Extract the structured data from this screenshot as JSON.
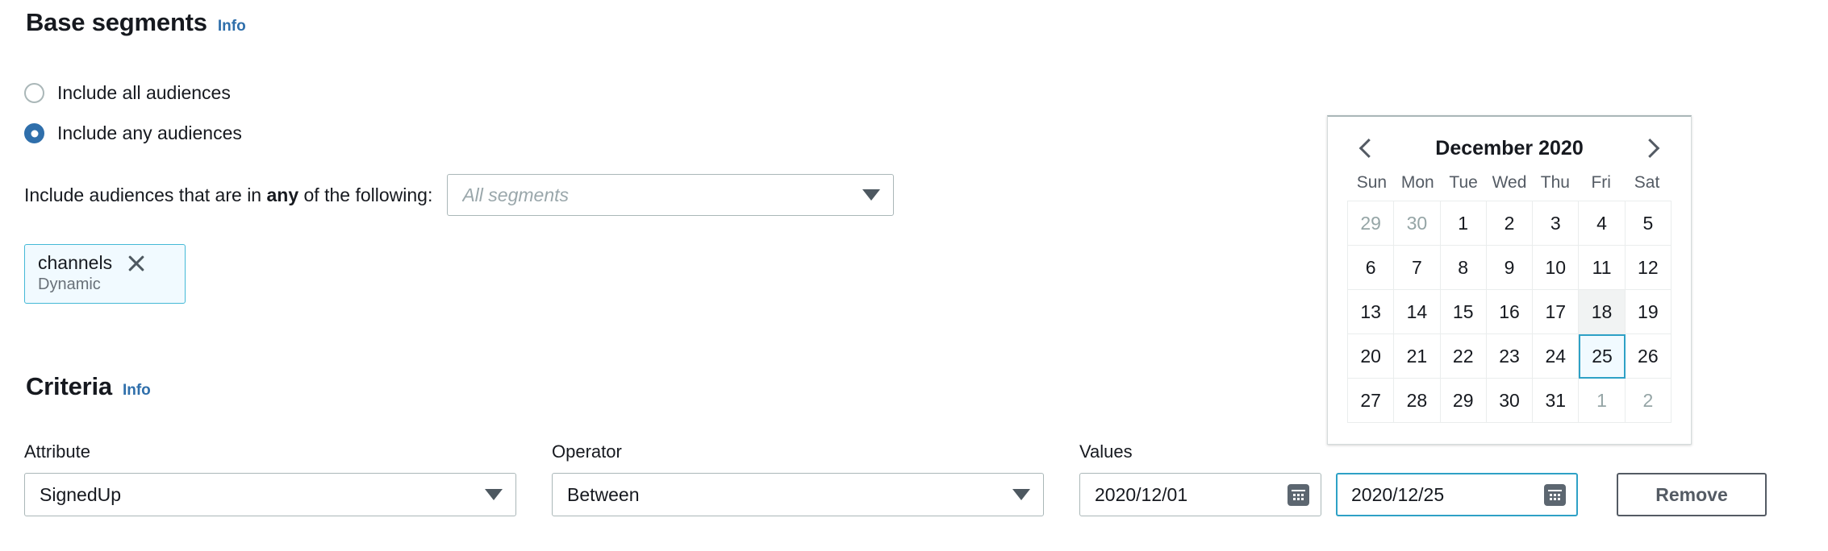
{
  "base_segments": {
    "heading": "Base segments",
    "info_label": "Info",
    "radios": [
      {
        "label": "Include all audiences",
        "checked": false
      },
      {
        "label": "Include any audiences",
        "checked": true
      }
    ],
    "include_prefix": "Include audiences that are in ",
    "include_bold": "any",
    "include_suffix": " of the following:",
    "segments_select": {
      "placeholder": "All segments",
      "value": ""
    },
    "token": {
      "name": "channels",
      "type": "Dynamic",
      "close_icon": "close-icon"
    }
  },
  "criteria": {
    "heading": "Criteria",
    "info_label": "Info",
    "attribute": {
      "label": "Attribute",
      "value": "SignedUp"
    },
    "operator": {
      "label": "Operator",
      "value": "Between"
    },
    "values": {
      "label": "Values",
      "start_date": "2020/12/01",
      "end_date": "2020/12/25",
      "calendar_icon": "calendar-icon"
    },
    "remove_label": "Remove"
  },
  "calendar": {
    "month_title": "December 2020",
    "prev_icon": "chevron-left-icon",
    "next_icon": "chevron-right-icon",
    "weekdays": [
      "Sun",
      "Mon",
      "Tue",
      "Wed",
      "Thu",
      "Fri",
      "Sat"
    ],
    "selected_day": 25,
    "hovered_day": 18,
    "days": [
      {
        "n": "29",
        "muted": true
      },
      {
        "n": "30",
        "muted": true
      },
      {
        "n": "1",
        "muted": false
      },
      {
        "n": "2",
        "muted": false
      },
      {
        "n": "3",
        "muted": false
      },
      {
        "n": "4",
        "muted": false
      },
      {
        "n": "5",
        "muted": false
      },
      {
        "n": "6",
        "muted": false
      },
      {
        "n": "7",
        "muted": false
      },
      {
        "n": "8",
        "muted": false
      },
      {
        "n": "9",
        "muted": false
      },
      {
        "n": "10",
        "muted": false
      },
      {
        "n": "11",
        "muted": false
      },
      {
        "n": "12",
        "muted": false
      },
      {
        "n": "13",
        "muted": false
      },
      {
        "n": "14",
        "muted": false
      },
      {
        "n": "15",
        "muted": false
      },
      {
        "n": "16",
        "muted": false
      },
      {
        "n": "17",
        "muted": false
      },
      {
        "n": "18",
        "muted": false,
        "hovered": true
      },
      {
        "n": "19",
        "muted": false
      },
      {
        "n": "20",
        "muted": false
      },
      {
        "n": "21",
        "muted": false
      },
      {
        "n": "22",
        "muted": false
      },
      {
        "n": "23",
        "muted": false
      },
      {
        "n": "24",
        "muted": false
      },
      {
        "n": "25",
        "muted": false,
        "selected": true
      },
      {
        "n": "26",
        "muted": false
      },
      {
        "n": "27",
        "muted": false
      },
      {
        "n": "28",
        "muted": false
      },
      {
        "n": "29",
        "muted": false
      },
      {
        "n": "30",
        "muted": false
      },
      {
        "n": "31",
        "muted": false
      },
      {
        "n": "1",
        "muted": true
      },
      {
        "n": "2",
        "muted": true
      }
    ]
  },
  "colors": {
    "accent_blue": "#2f6fab",
    "focus_blue": "#2ea1c6",
    "token_bg": "#f1faff",
    "text": "#16191f",
    "muted_text": "#95a5a6",
    "border": "#aab7b8"
  }
}
